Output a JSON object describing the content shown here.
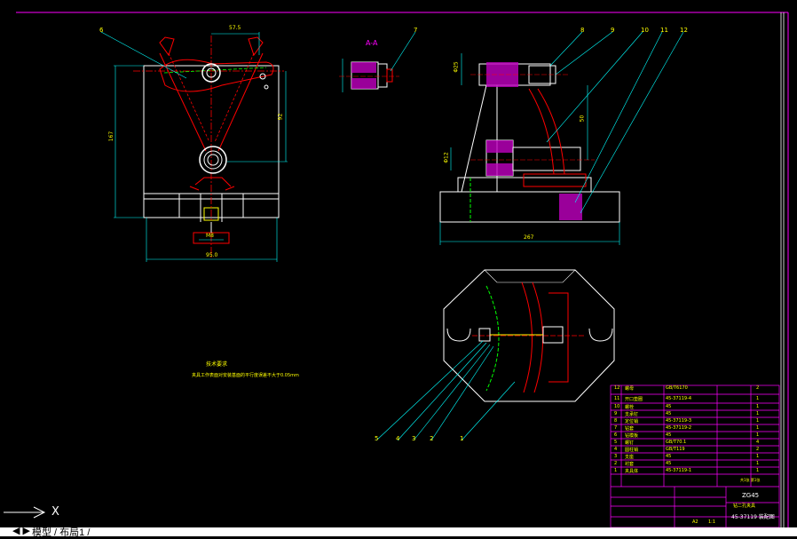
{
  "drawing": {
    "section_label": "A-A",
    "dims": {
      "top_width": "57.5",
      "left_height": "167",
      "right_height": "92",
      "bottom_width": "95.0",
      "bolt_dim": "M8",
      "right_bottom_width": "267",
      "right_mid_height": "50",
      "right_small_1": "Φ25",
      "right_small_2": "Φ12"
    },
    "balloons_top": [
      "6",
      "7",
      "8",
      "9",
      "10",
      "11",
      "12"
    ],
    "balloons_bottom": [
      "5",
      "4",
      "3",
      "2",
      "1"
    ],
    "tech_req_title": "技术要求",
    "tech_req_text": "夹具工作表面对安装基面的平行度误差不大于0.05mm"
  },
  "title_block": {
    "rows": [
      {
        "no": "12",
        "name": "螺母",
        "code": "GB/T6170",
        "qty": "2"
      },
      {
        "no": "11",
        "name": "开口垫圈",
        "code": "45-37119-4",
        "qty": "1"
      },
      {
        "no": "10",
        "name": "螺栓",
        "code": "45",
        "qty": "1"
      },
      {
        "no": "9",
        "name": "支承钉",
        "code": "45",
        "qty": "1"
      },
      {
        "no": "8",
        "name": "定位销",
        "code": "45-37119-3",
        "qty": "1"
      },
      {
        "no": "7",
        "name": "钻套",
        "code": "45-37119-2",
        "qty": "1"
      },
      {
        "no": "6",
        "name": "钻模板",
        "code": "45",
        "qty": "1"
      },
      {
        "no": "5",
        "name": "螺钉",
        "code": "GB/T70.1",
        "qty": "4"
      },
      {
        "no": "4",
        "name": "圆柱销",
        "code": "GB/T119",
        "qty": "2"
      },
      {
        "no": "3",
        "name": "支座",
        "code": "45",
        "qty": "1"
      },
      {
        "no": "2",
        "name": "衬套",
        "code": "45",
        "qty": "1"
      },
      {
        "no": "1",
        "name": "夹具体",
        "code": "45-37119-1",
        "qty": "1"
      }
    ],
    "header_note": "共1张 第1张",
    "material": "ZG45",
    "part_title": "钻二孔夹具",
    "drawing_no": "45-37119 装配图",
    "scale_a": "A2",
    "scale_b": "1:1"
  },
  "ui": {
    "tab_label": "模型 / 布局1 /",
    "ucs_x": "X"
  }
}
